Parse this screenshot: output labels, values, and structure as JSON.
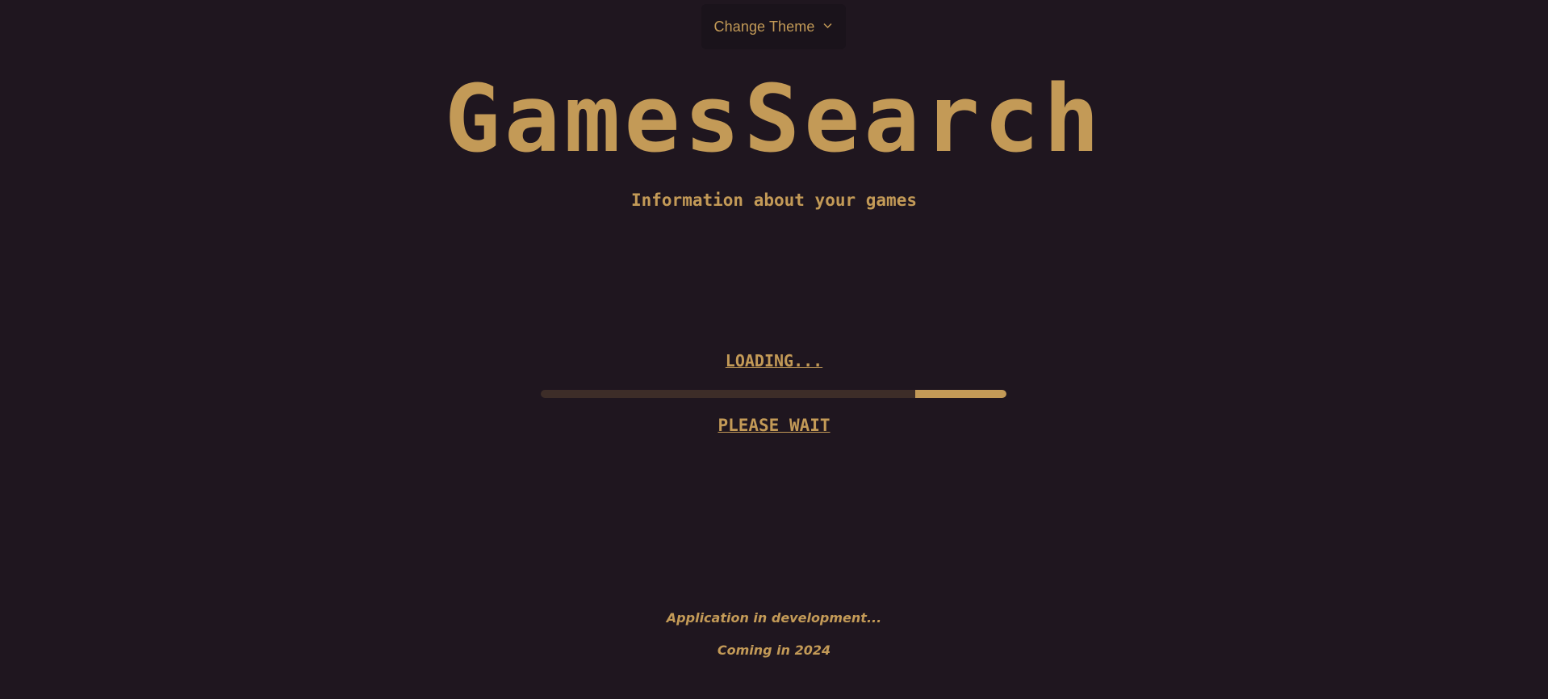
{
  "theme_menu": {
    "label": "Change Theme",
    "icon": "chevron-down-icon"
  },
  "header": {
    "title": "GamesSearch",
    "subtitle": "Information about your games"
  },
  "loader": {
    "status": "LOADING...",
    "progress_start": 0.805,
    "progress_end": 1.0,
    "message": "PLEASE WAIT"
  },
  "footer": {
    "line1": "Application in development...",
    "line2": "Coming in 2024"
  },
  "colors": {
    "background": "#1f161f",
    "accent": "#c39a57",
    "track": "#3d2d28",
    "button_bg": "#1a131b"
  }
}
